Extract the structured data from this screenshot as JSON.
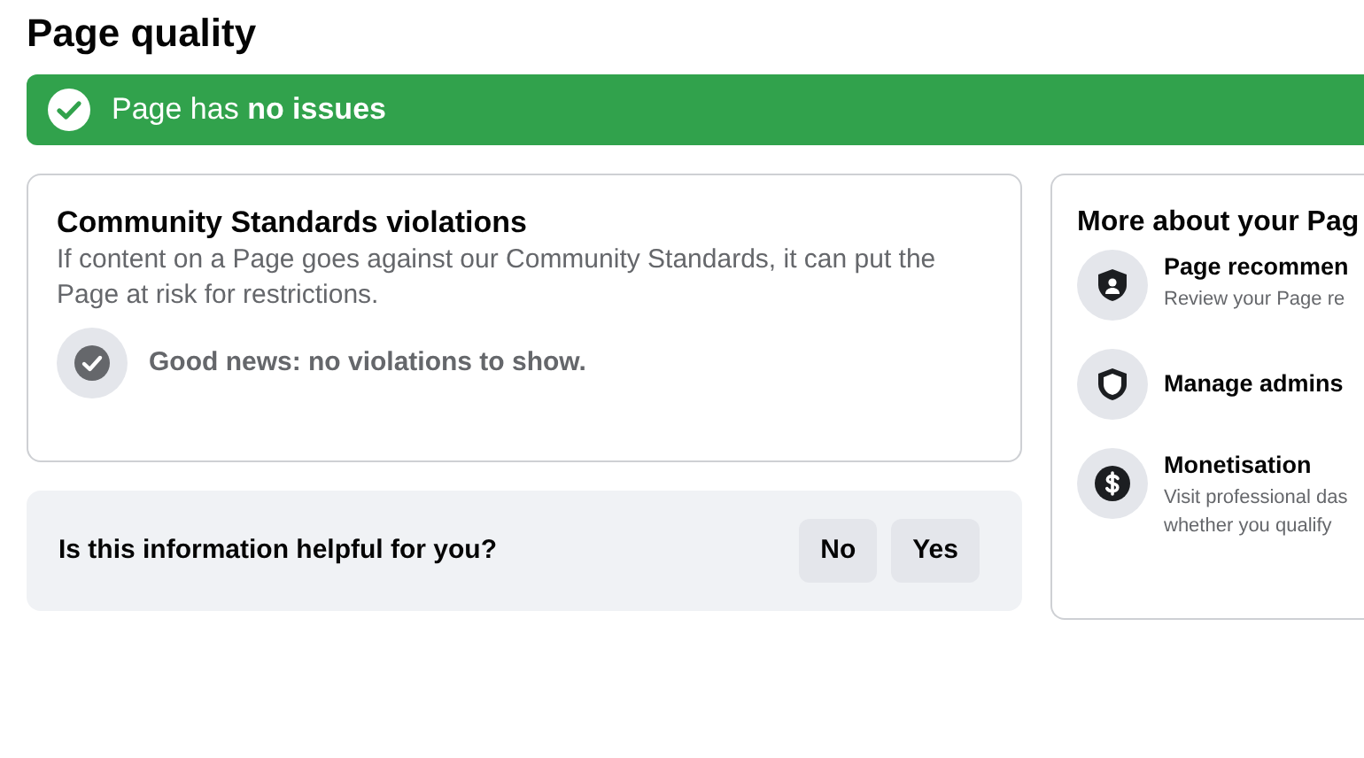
{
  "title": "Page quality",
  "banner": {
    "text": "Page has **no issues**"
  },
  "violations_card": {
    "title": "Community Standards violations",
    "description": "If content on a Page goes against our Community Standards, it can put the Page at risk for restrictions.",
    "status": "Good news: no violations to show."
  },
  "feedback": {
    "question": "Is this information helpful for you?",
    "buttons": [
      "No",
      "Yes"
    ]
  },
  "more_card": {
    "title": "More about your Pag",
    "items": [
      {
        "kind": "recommendation",
        "title": "Page recommen",
        "description": [
          "Review your Page re"
        ]
      },
      {
        "kind": "admins",
        "title": "Manage admins"
      },
      {
        "kind": "monetisation",
        "title": "Monetisation",
        "description": [
          "Visit professional das",
          "whether you qualify"
        ]
      }
    ]
  }
}
